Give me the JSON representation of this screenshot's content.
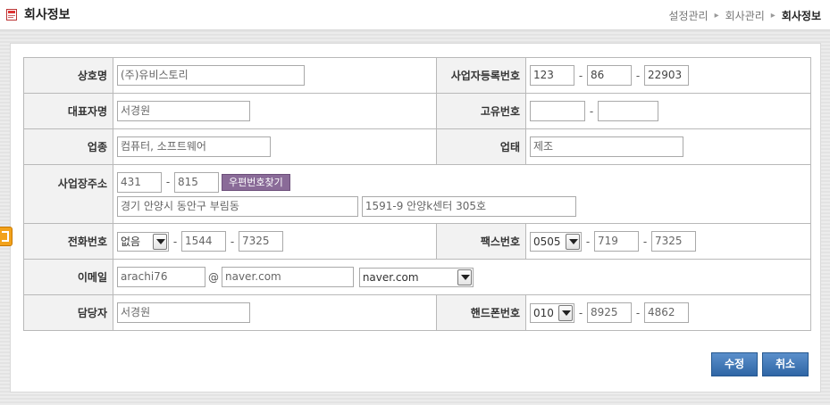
{
  "page_title": "회사정보",
  "breadcrumb": [
    "설정관리",
    "회사관리",
    "회사정보"
  ],
  "labels": {
    "company_name": "상호명",
    "biz_reg_no": "사업자등록번호",
    "ceo": "대표자명",
    "unique_no": "고유번호",
    "business_type": "업종",
    "business_category": "업태",
    "address": "사업장주소",
    "phone": "전화번호",
    "fax": "팩스번호",
    "email": "이메일",
    "manager": "담당자",
    "mobile": "핸드폰번호"
  },
  "values": {
    "company_name": "(주)유비스토리",
    "biz_reg_no": [
      "123",
      "86",
      "22903"
    ],
    "ceo": "서경원",
    "unique_no": [
      "",
      ""
    ],
    "business_type": "컴퓨터, 소프트웨어",
    "business_category": "제조",
    "zip": [
      "431",
      "815"
    ],
    "zip_button": "우편번호찾기",
    "address1": "경기 안양시 동안구 부림동",
    "address2": "1591-9 안양k센터 305호",
    "phone_area": "없음",
    "phone": [
      "1544",
      "7325"
    ],
    "fax_area": "0505",
    "fax": [
      "719",
      "7325"
    ],
    "email_id": "arachi76",
    "email_at": "@",
    "email_domain": "naver.com",
    "email_domain_select": "naver.com",
    "manager": "서경원",
    "mobile_prefix": "010",
    "mobile": [
      "8925",
      "4862"
    ]
  },
  "separator": "-",
  "buttons": {
    "edit": "수정",
    "cancel": "취소"
  }
}
